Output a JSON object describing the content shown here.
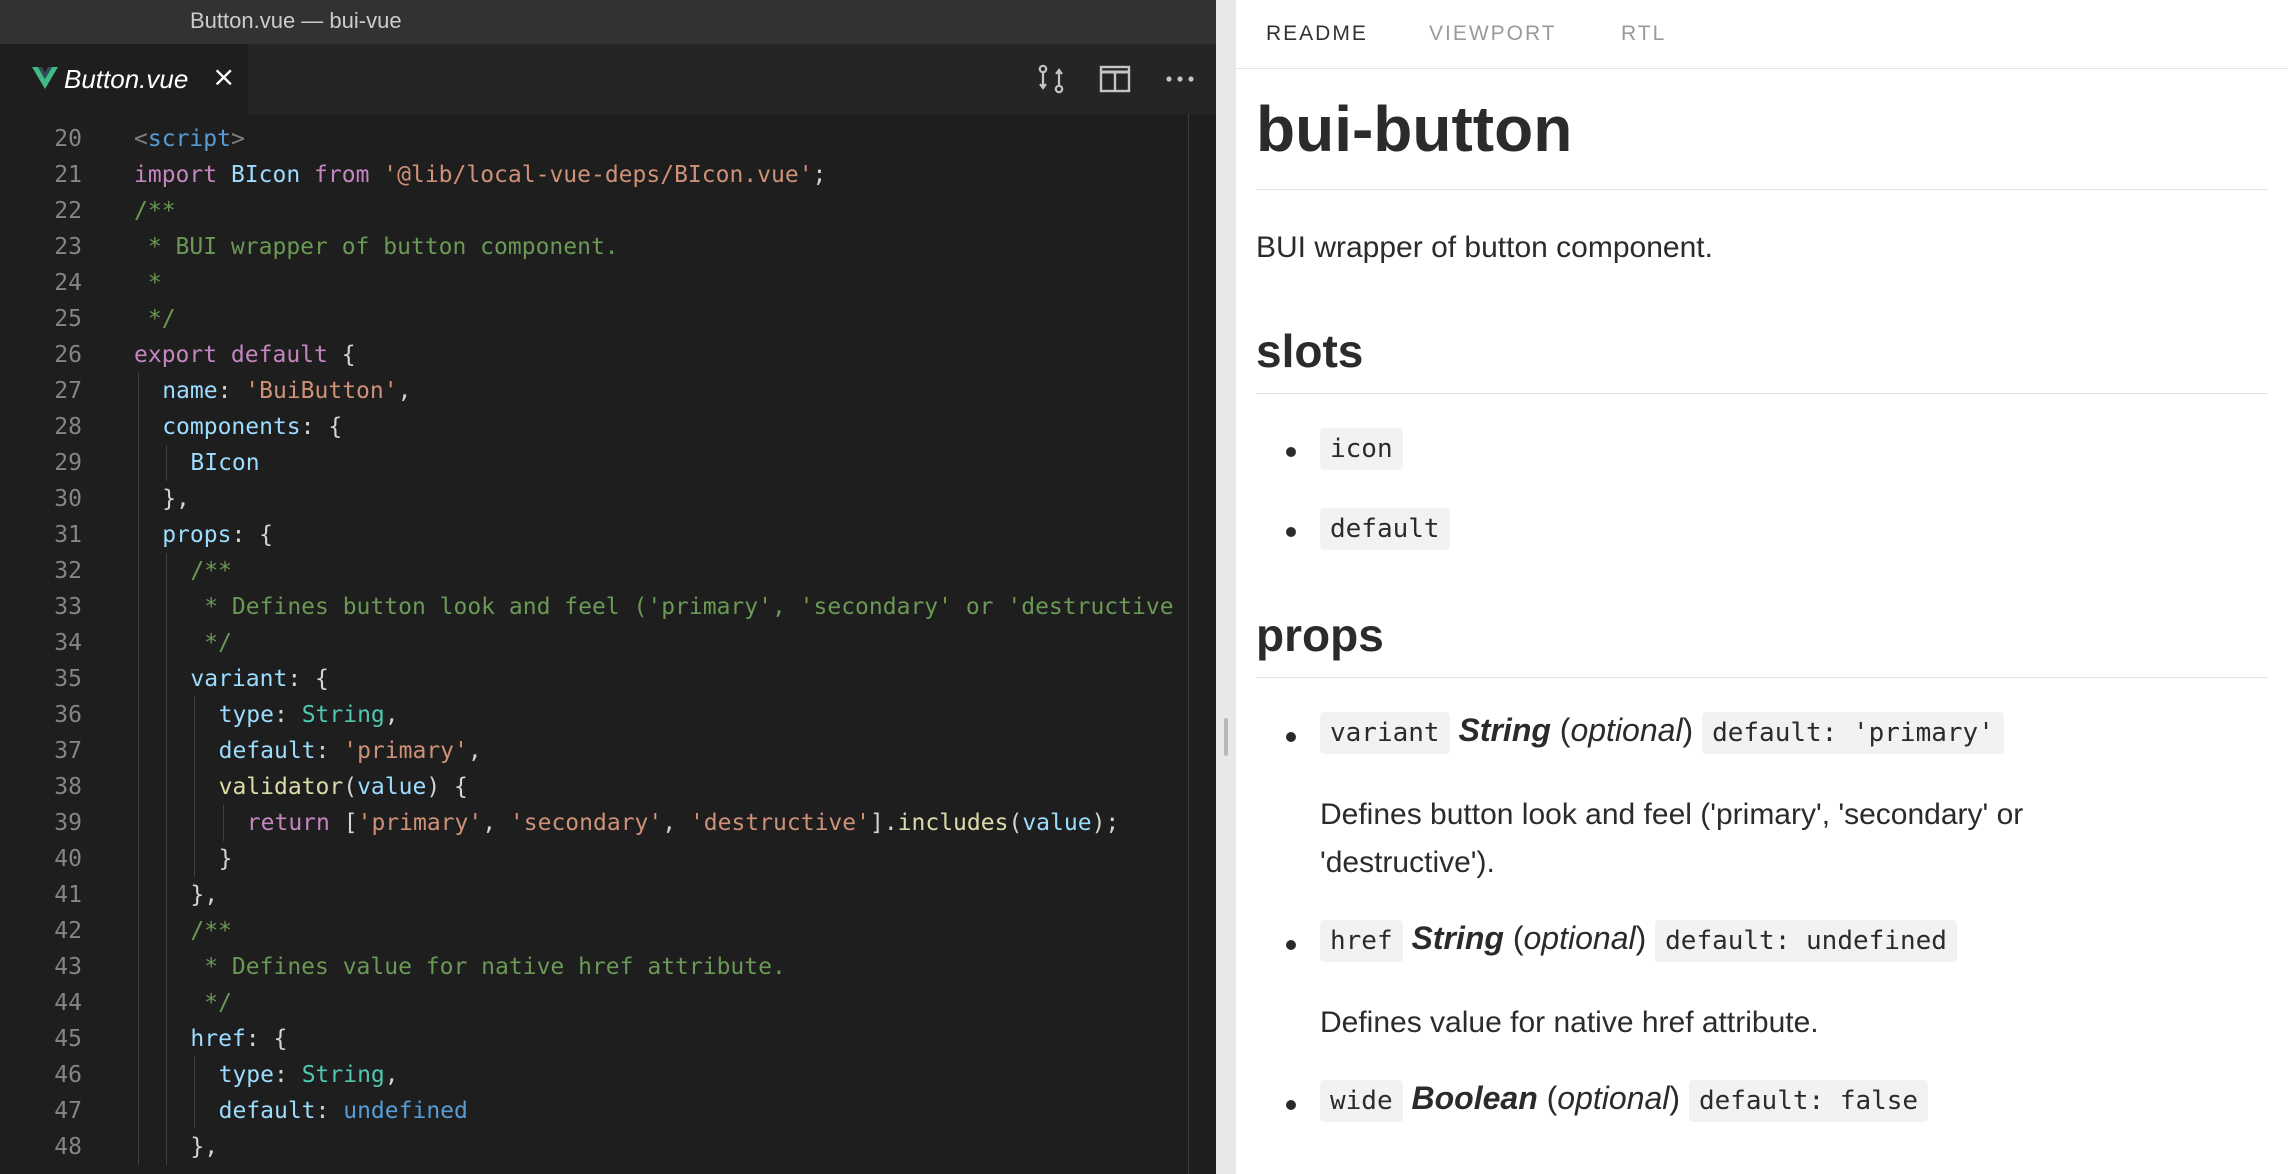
{
  "window": {
    "title": "Button.vue — bui-vue"
  },
  "editor_tab": {
    "label": "Button.vue",
    "close_glyph": "×",
    "icon": "vue-icon"
  },
  "toolbar": {
    "icons": [
      "open-changes-icon",
      "split-editor-icon",
      "more-actions-icon"
    ]
  },
  "code": {
    "first_line": 20,
    "lines": [
      {
        "n": 20,
        "indent": 0,
        "tokens": [
          [
            "tagb",
            "<"
          ],
          [
            "tag",
            "script"
          ],
          [
            "tagb",
            ">"
          ]
        ]
      },
      {
        "n": 21,
        "indent": 0,
        "tokens": [
          [
            "kw",
            "import "
          ],
          [
            "id",
            "BIcon "
          ],
          [
            "kw",
            "from "
          ],
          [
            "str",
            "'@lib/local-vue-deps/BIcon.vue'"
          ],
          [
            "punc",
            ";"
          ]
        ]
      },
      {
        "n": 22,
        "indent": 0,
        "tokens": [
          [
            "com",
            "/**"
          ]
        ]
      },
      {
        "n": 23,
        "indent": 0,
        "tokens": [
          [
            "com",
            " * BUI wrapper of button component."
          ]
        ]
      },
      {
        "n": 24,
        "indent": 0,
        "tokens": [
          [
            "com",
            " *"
          ]
        ]
      },
      {
        "n": 25,
        "indent": 0,
        "tokens": [
          [
            "com",
            " */"
          ]
        ]
      },
      {
        "n": 26,
        "indent": 0,
        "tokens": [
          [
            "kw",
            "export default "
          ],
          [
            "punc",
            "{"
          ]
        ]
      },
      {
        "n": 27,
        "indent": 1,
        "tokens": [
          [
            "prop",
            "name"
          ],
          [
            "punc",
            ": "
          ],
          [
            "str",
            "'BuiButton'"
          ],
          [
            "punc",
            ","
          ]
        ]
      },
      {
        "n": 28,
        "indent": 1,
        "tokens": [
          [
            "prop",
            "components"
          ],
          [
            "punc",
            ": {"
          ]
        ]
      },
      {
        "n": 29,
        "indent": 2,
        "tokens": [
          [
            "id",
            "BIcon"
          ]
        ]
      },
      {
        "n": 30,
        "indent": 1,
        "tokens": [
          [
            "punc",
            "},"
          ]
        ]
      },
      {
        "n": 31,
        "indent": 1,
        "tokens": [
          [
            "prop",
            "props"
          ],
          [
            "punc",
            ": {"
          ]
        ]
      },
      {
        "n": 32,
        "indent": 2,
        "tokens": [
          [
            "com",
            "/**"
          ]
        ]
      },
      {
        "n": 33,
        "indent": 2,
        "tokens": [
          [
            "com",
            " * Defines button look and feel ('primary', 'secondary' or 'destructive"
          ]
        ]
      },
      {
        "n": 34,
        "indent": 2,
        "tokens": [
          [
            "com",
            " */"
          ]
        ]
      },
      {
        "n": 35,
        "indent": 2,
        "tokens": [
          [
            "prop",
            "variant"
          ],
          [
            "punc",
            ": {"
          ]
        ]
      },
      {
        "n": 36,
        "indent": 3,
        "tokens": [
          [
            "prop",
            "type"
          ],
          [
            "punc",
            ": "
          ],
          [
            "typ",
            "String"
          ],
          [
            "punc",
            ","
          ]
        ]
      },
      {
        "n": 37,
        "indent": 3,
        "tokens": [
          [
            "prop",
            "default"
          ],
          [
            "punc",
            ": "
          ],
          [
            "str",
            "'primary'"
          ],
          [
            "punc",
            ","
          ]
        ]
      },
      {
        "n": 38,
        "indent": 3,
        "tokens": [
          [
            "fn",
            "validator"
          ],
          [
            "punc",
            "("
          ],
          [
            "id",
            "value"
          ],
          [
            "punc",
            ") {"
          ]
        ]
      },
      {
        "n": 39,
        "indent": 4,
        "tokens": [
          [
            "kw",
            "return "
          ],
          [
            "punc",
            "["
          ],
          [
            "str",
            "'primary'"
          ],
          [
            "punc",
            ", "
          ],
          [
            "str",
            "'secondary'"
          ],
          [
            "punc",
            ", "
          ],
          [
            "str",
            "'destructive'"
          ],
          [
            "punc",
            "]."
          ],
          [
            "fn",
            "includes"
          ],
          [
            "punc",
            "("
          ],
          [
            "id",
            "value"
          ],
          [
            "punc",
            ");"
          ]
        ]
      },
      {
        "n": 40,
        "indent": 3,
        "tokens": [
          [
            "punc",
            "}"
          ]
        ]
      },
      {
        "n": 41,
        "indent": 2,
        "tokens": [
          [
            "punc",
            "},"
          ]
        ]
      },
      {
        "n": 42,
        "indent": 2,
        "tokens": [
          [
            "com",
            "/**"
          ]
        ]
      },
      {
        "n": 43,
        "indent": 2,
        "tokens": [
          [
            "com",
            " * Defines value for native href attribute."
          ]
        ]
      },
      {
        "n": 44,
        "indent": 2,
        "tokens": [
          [
            "com",
            " */"
          ]
        ]
      },
      {
        "n": 45,
        "indent": 2,
        "tokens": [
          [
            "prop",
            "href"
          ],
          [
            "punc",
            ": {"
          ]
        ]
      },
      {
        "n": 46,
        "indent": 3,
        "tokens": [
          [
            "prop",
            "type"
          ],
          [
            "punc",
            ": "
          ],
          [
            "typ",
            "String"
          ],
          [
            "punc",
            ","
          ]
        ]
      },
      {
        "n": 47,
        "indent": 3,
        "tokens": [
          [
            "prop",
            "default"
          ],
          [
            "punc",
            ": "
          ],
          [
            "lit",
            "undefined"
          ]
        ]
      },
      {
        "n": 48,
        "indent": 2,
        "tokens": [
          [
            "punc",
            "},"
          ]
        ]
      }
    ]
  },
  "panel": {
    "tabs": [
      {
        "label": "README",
        "active": true
      },
      {
        "label": "VIEWPORT",
        "active": false
      },
      {
        "label": "RTL",
        "active": false
      }
    ],
    "title": "bui-button",
    "description": "BUI wrapper of button component.",
    "slots_heading": "slots",
    "slots": [
      "icon",
      "default"
    ],
    "props_heading": "props",
    "props": [
      {
        "name": "variant",
        "type": "String",
        "open": "(",
        "optional": "optional",
        "close": ")",
        "default": "default: 'primary'",
        "description_lines": [
          "Defines button look and feel ('primary', 'secondary' or",
          "'destructive')."
        ]
      },
      {
        "name": "href",
        "type": "String",
        "open": "(",
        "optional": "optional",
        "close": ")",
        "default": "default: undefined",
        "description_lines": [
          "Defines value for native href attribute."
        ]
      },
      {
        "name": "wide",
        "type": "Boolean",
        "open": "(",
        "optional": "optional",
        "close": ")",
        "default": "default: false",
        "description_lines": []
      }
    ]
  },
  "colors": {
    "editor_bg": "#1e1e1e",
    "titlebar_bg": "#323233",
    "tabbar_bg": "#252526",
    "vue_green": "#42b883",
    "keyword": "#c586c0",
    "string": "#ce9178",
    "comment": "#6a9955",
    "property": "#9cdcfe",
    "type": "#4ec9b0"
  }
}
